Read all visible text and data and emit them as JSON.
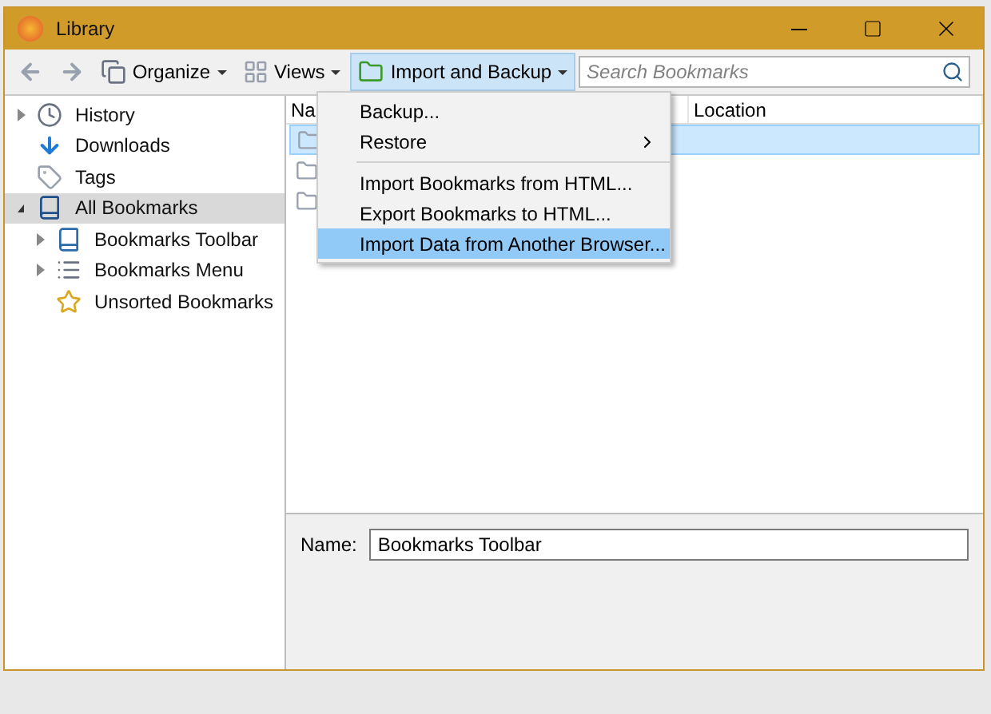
{
  "window": {
    "title": "Library"
  },
  "toolbar": {
    "organize": "Organize",
    "views": "Views",
    "import_backup": "Import and Backup",
    "import_backup_selected": true,
    "search": {
      "placeholder": "Search Bookmarks"
    }
  },
  "sidebar": {
    "items": [
      {
        "label": "History",
        "kind": "history",
        "expanded": false,
        "selected": false
      },
      {
        "label": "Downloads",
        "kind": "downloads",
        "selected": false
      },
      {
        "label": "Tags",
        "kind": "tags",
        "selected": false
      },
      {
        "label": "All Bookmarks",
        "kind": "all",
        "expanded": true,
        "selected": true,
        "children": [
          {
            "label": "Bookmarks Toolbar",
            "kind": "toolbar",
            "expanded": false,
            "selected": false
          },
          {
            "label": "Bookmarks Menu",
            "kind": "menu",
            "expanded": false,
            "selected": false
          },
          {
            "label": "Unsorted Bookmarks",
            "kind": "unsorted",
            "selected": false
          }
        ]
      }
    ]
  },
  "table": {
    "columns": [
      "Na",
      "Location"
    ],
    "rows": [
      {
        "selected": true
      },
      {
        "selected": false
      },
      {
        "selected": false
      }
    ]
  },
  "menu": {
    "items": [
      {
        "label": "Backup...",
        "kind": "item",
        "selected": false
      },
      {
        "label": "Restore",
        "kind": "submenu",
        "selected": false
      },
      {
        "kind": "separator"
      },
      {
        "label": "Import Bookmarks from HTML...",
        "kind": "item",
        "selected": false
      },
      {
        "label": "Export Bookmarks to HTML...",
        "kind": "item",
        "selected": false
      },
      {
        "label": "Import Data from Another Browser...",
        "kind": "item",
        "selected": true
      }
    ]
  },
  "details": {
    "name_label": "Name:",
    "name_value": "Bookmarks Toolbar"
  }
}
